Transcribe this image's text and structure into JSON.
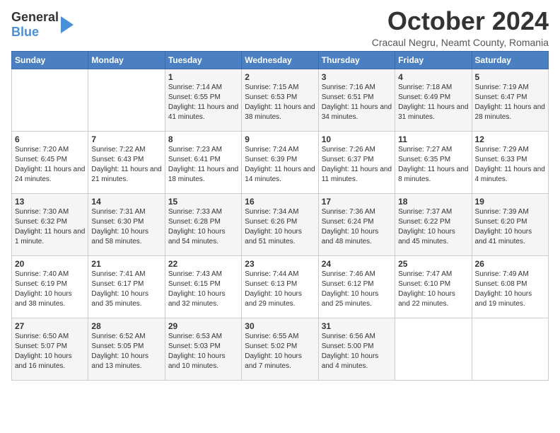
{
  "header": {
    "logo_general": "General",
    "logo_blue": "Blue",
    "title": "October 2024",
    "subtitle": "Cracaul Negru, Neamt County, Romania"
  },
  "days_of_week": [
    "Sunday",
    "Monday",
    "Tuesday",
    "Wednesday",
    "Thursday",
    "Friday",
    "Saturday"
  ],
  "weeks": [
    [
      {
        "day": "",
        "info": ""
      },
      {
        "day": "",
        "info": ""
      },
      {
        "day": "1",
        "info": "Sunrise: 7:14 AM\nSunset: 6:55 PM\nDaylight: 11 hours and 41 minutes."
      },
      {
        "day": "2",
        "info": "Sunrise: 7:15 AM\nSunset: 6:53 PM\nDaylight: 11 hours and 38 minutes."
      },
      {
        "day": "3",
        "info": "Sunrise: 7:16 AM\nSunset: 6:51 PM\nDaylight: 11 hours and 34 minutes."
      },
      {
        "day": "4",
        "info": "Sunrise: 7:18 AM\nSunset: 6:49 PM\nDaylight: 11 hours and 31 minutes."
      },
      {
        "day": "5",
        "info": "Sunrise: 7:19 AM\nSunset: 6:47 PM\nDaylight: 11 hours and 28 minutes."
      }
    ],
    [
      {
        "day": "6",
        "info": "Sunrise: 7:20 AM\nSunset: 6:45 PM\nDaylight: 11 hours and 24 minutes."
      },
      {
        "day": "7",
        "info": "Sunrise: 7:22 AM\nSunset: 6:43 PM\nDaylight: 11 hours and 21 minutes."
      },
      {
        "day": "8",
        "info": "Sunrise: 7:23 AM\nSunset: 6:41 PM\nDaylight: 11 hours and 18 minutes."
      },
      {
        "day": "9",
        "info": "Sunrise: 7:24 AM\nSunset: 6:39 PM\nDaylight: 11 hours and 14 minutes."
      },
      {
        "day": "10",
        "info": "Sunrise: 7:26 AM\nSunset: 6:37 PM\nDaylight: 11 hours and 11 minutes."
      },
      {
        "day": "11",
        "info": "Sunrise: 7:27 AM\nSunset: 6:35 PM\nDaylight: 11 hours and 8 minutes."
      },
      {
        "day": "12",
        "info": "Sunrise: 7:29 AM\nSunset: 6:33 PM\nDaylight: 11 hours and 4 minutes."
      }
    ],
    [
      {
        "day": "13",
        "info": "Sunrise: 7:30 AM\nSunset: 6:32 PM\nDaylight: 11 hours and 1 minute."
      },
      {
        "day": "14",
        "info": "Sunrise: 7:31 AM\nSunset: 6:30 PM\nDaylight: 10 hours and 58 minutes."
      },
      {
        "day": "15",
        "info": "Sunrise: 7:33 AM\nSunset: 6:28 PM\nDaylight: 10 hours and 54 minutes."
      },
      {
        "day": "16",
        "info": "Sunrise: 7:34 AM\nSunset: 6:26 PM\nDaylight: 10 hours and 51 minutes."
      },
      {
        "day": "17",
        "info": "Sunrise: 7:36 AM\nSunset: 6:24 PM\nDaylight: 10 hours and 48 minutes."
      },
      {
        "day": "18",
        "info": "Sunrise: 7:37 AM\nSunset: 6:22 PM\nDaylight: 10 hours and 45 minutes."
      },
      {
        "day": "19",
        "info": "Sunrise: 7:39 AM\nSunset: 6:20 PM\nDaylight: 10 hours and 41 minutes."
      }
    ],
    [
      {
        "day": "20",
        "info": "Sunrise: 7:40 AM\nSunset: 6:19 PM\nDaylight: 10 hours and 38 minutes."
      },
      {
        "day": "21",
        "info": "Sunrise: 7:41 AM\nSunset: 6:17 PM\nDaylight: 10 hours and 35 minutes."
      },
      {
        "day": "22",
        "info": "Sunrise: 7:43 AM\nSunset: 6:15 PM\nDaylight: 10 hours and 32 minutes."
      },
      {
        "day": "23",
        "info": "Sunrise: 7:44 AM\nSunset: 6:13 PM\nDaylight: 10 hours and 29 minutes."
      },
      {
        "day": "24",
        "info": "Sunrise: 7:46 AM\nSunset: 6:12 PM\nDaylight: 10 hours and 25 minutes."
      },
      {
        "day": "25",
        "info": "Sunrise: 7:47 AM\nSunset: 6:10 PM\nDaylight: 10 hours and 22 minutes."
      },
      {
        "day": "26",
        "info": "Sunrise: 7:49 AM\nSunset: 6:08 PM\nDaylight: 10 hours and 19 minutes."
      }
    ],
    [
      {
        "day": "27",
        "info": "Sunrise: 6:50 AM\nSunset: 5:07 PM\nDaylight: 10 hours and 16 minutes."
      },
      {
        "day": "28",
        "info": "Sunrise: 6:52 AM\nSunset: 5:05 PM\nDaylight: 10 hours and 13 minutes."
      },
      {
        "day": "29",
        "info": "Sunrise: 6:53 AM\nSunset: 5:03 PM\nDaylight: 10 hours and 10 minutes."
      },
      {
        "day": "30",
        "info": "Sunrise: 6:55 AM\nSunset: 5:02 PM\nDaylight: 10 hours and 7 minutes."
      },
      {
        "day": "31",
        "info": "Sunrise: 6:56 AM\nSunset: 5:00 PM\nDaylight: 10 hours and 4 minutes."
      },
      {
        "day": "",
        "info": ""
      },
      {
        "day": "",
        "info": ""
      }
    ]
  ]
}
